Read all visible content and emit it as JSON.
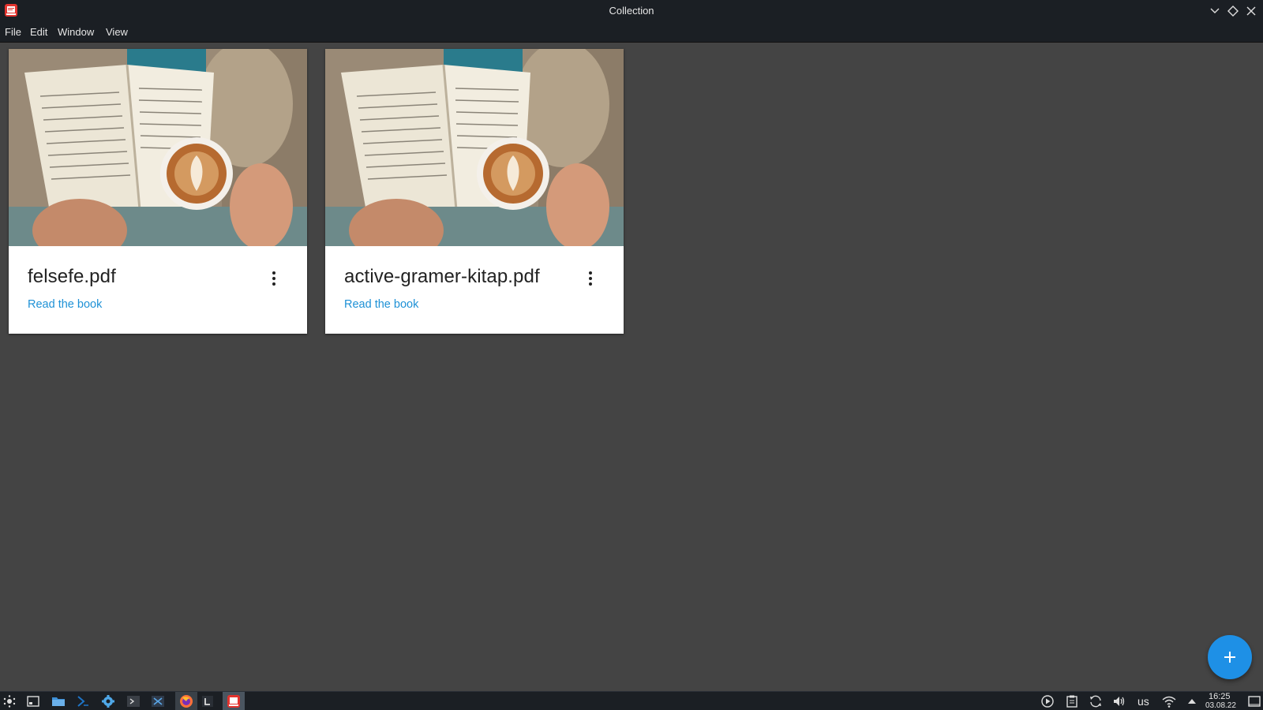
{
  "window": {
    "title": "Collection"
  },
  "menu": [
    "File",
    "Edit",
    "Window",
    "View"
  ],
  "books": [
    {
      "title": "felsefe.pdf",
      "action_label": "Read the book"
    },
    {
      "title": "active-gramer-kitap.pdf",
      "action_label": "Read the book"
    }
  ],
  "fab": {
    "icon": "plus-icon"
  },
  "taskbar": {
    "keyboard_layout": "us",
    "time": "16:25",
    "date": "03.08.22"
  },
  "colors": {
    "background": "#444444",
    "titlebar": "#1b1f24",
    "accent": "#1e90e6",
    "link": "#1e91d6",
    "card": "#ffffff"
  }
}
